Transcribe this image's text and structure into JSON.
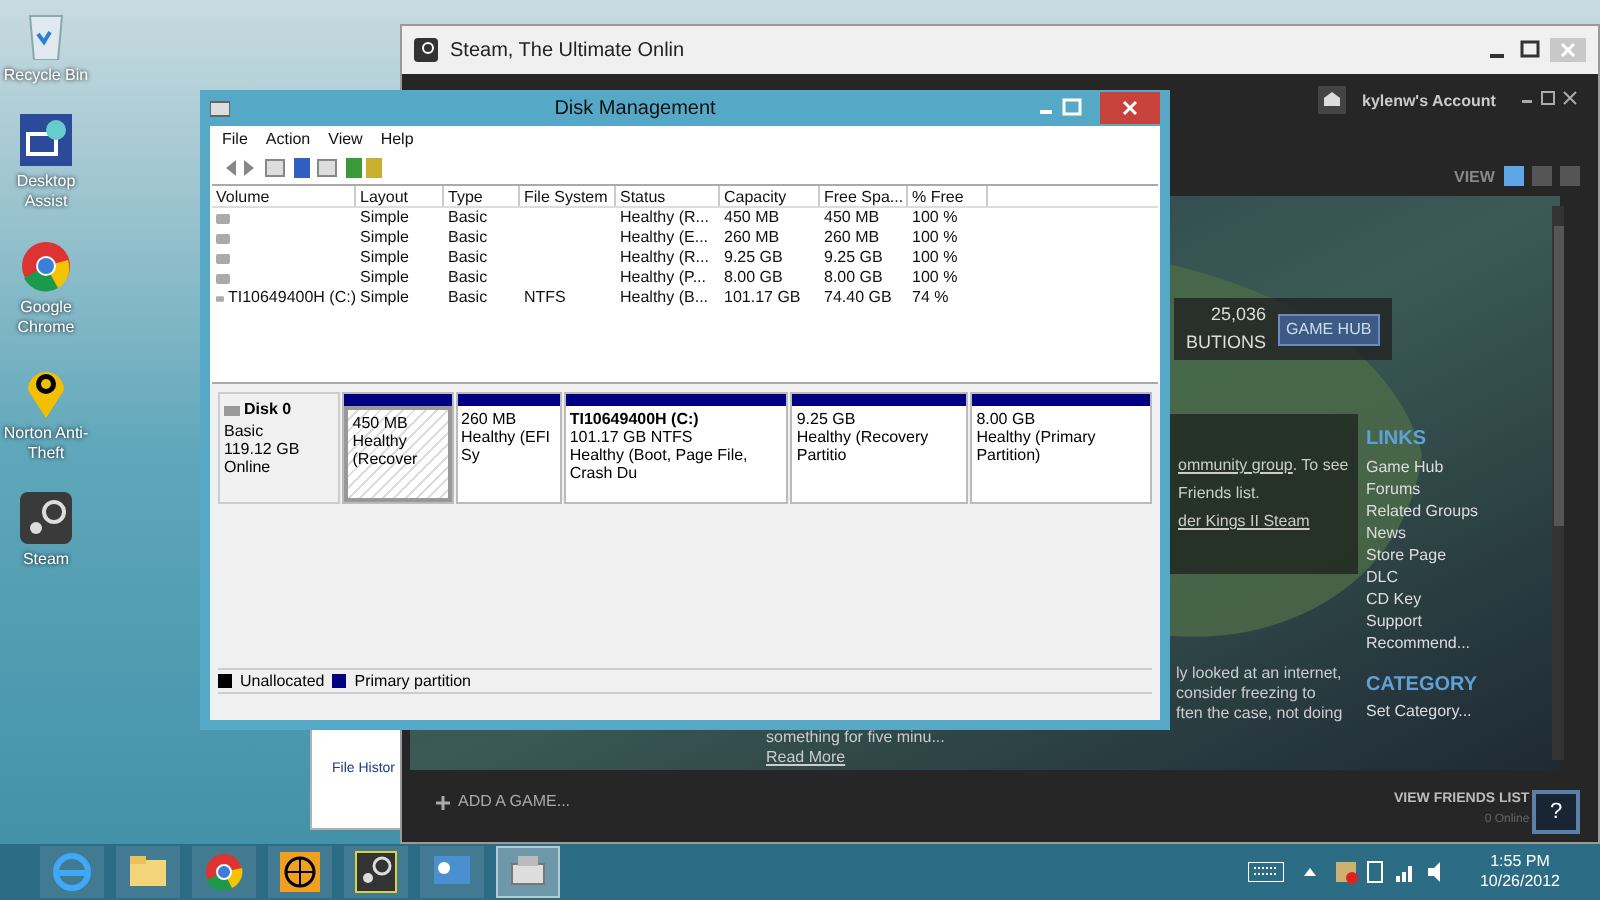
{
  "desktop_icons": [
    {
      "label": "Recycle Bin"
    },
    {
      "label": "Desktop Assist"
    },
    {
      "label": "Google Chrome"
    },
    {
      "label": "Norton Anti-Theft"
    },
    {
      "label": "Steam"
    }
  ],
  "file_history_window": {
    "label": "File Histor"
  },
  "steam": {
    "title": "Steam, The Ultimate Onlin",
    "account": "kylenw's Account",
    "view_label": "VIEW",
    "view_modes": [
      {
        "selected": true
      },
      {
        "selected": false
      },
      {
        "selected": false
      }
    ],
    "contributions": {
      "count": "25,036",
      "label": "BUTIONS"
    },
    "game_hub_button": "GAME HUB",
    "news_lines": [
      {
        "text": "ommunity group",
        "link": true
      },
      {
        "text": ". To see",
        "link": false
      },
      {
        "text": "Friends list.",
        "link": false
      },
      {
        "text": "der Kings II Steam",
        "link": true
      }
    ],
    "links_heading": "LINKS",
    "links": [
      "Game Hub",
      "Forums",
      "Related Groups",
      "News",
      "Store Page",
      "DLC",
      "CD Key",
      "Support",
      "Recommend..."
    ],
    "category_heading": "CATEGORY",
    "category_link": "Set Category...",
    "description_lines": [
      "ly looked at an internet,",
      "consider freezing to",
      "ften the case, not doing"
    ],
    "description_tail": "something for five minu...",
    "read_more": "Read More",
    "add_game": "ADD A GAME...",
    "friends": {
      "label": "VIEW FRIENDS LIST",
      "status": "0 Online"
    },
    "help_button": "?"
  },
  "disk_management": {
    "title": "Disk Management",
    "menu": [
      "File",
      "Action",
      "View",
      "Help"
    ],
    "volume_table": {
      "columns": [
        "Volume",
        "Layout",
        "Type",
        "File System",
        "Status",
        "Capacity",
        "Free Spa...",
        "% Free"
      ],
      "rows": [
        {
          "layout": "Simple",
          "type": "Basic",
          "status": "Healthy (R...",
          "capacity": "450 MB",
          "free": "450 MB",
          "percent_free": "100 %"
        },
        {
          "layout": "Simple",
          "type": "Basic",
          "status": "Healthy (E...",
          "capacity": "260 MB",
          "free": "260 MB",
          "percent_free": "100 %"
        },
        {
          "layout": "Simple",
          "type": "Basic",
          "status": "Healthy (R...",
          "capacity": "9.25 GB",
          "free": "9.25 GB",
          "percent_free": "100 %"
        },
        {
          "layout": "Simple",
          "type": "Basic",
          "status": "Healthy (P...",
          "capacity": "8.00 GB",
          "free": "8.00 GB",
          "percent_free": "100 %"
        },
        {
          "volume": "TI10649400H (C:)",
          "layout": "Simple",
          "type": "Basic",
          "file_system": "NTFS",
          "status": "Healthy (B...",
          "capacity": "101.17 GB",
          "free": "74.40 GB",
          "percent_free": "74 %"
        }
      ]
    },
    "disk": {
      "name": "Disk 0",
      "type": "Basic",
      "size": "119.12 GB",
      "status": "Online"
    },
    "partitions": [
      {
        "size": "450 MB",
        "status": "Healthy (Recover",
        "selected": true
      },
      {
        "size": "260 MB",
        "status": "Healthy (EFI Sy",
        "selected": false
      },
      {
        "label": "TI10649400H  (C:)",
        "size": "101.17 GB NTFS",
        "status": "Healthy (Boot, Page File, Crash Du",
        "selected": false
      },
      {
        "size": "9.25 GB",
        "status": "Healthy (Recovery Partitio",
        "selected": false
      },
      {
        "size": "8.00 GB",
        "status": "Healthy (Primary Partition)",
        "selected": false
      }
    ],
    "legend": [
      {
        "label": "Unallocated",
        "color": "#000000"
      },
      {
        "label": "Primary partition",
        "color": "#000080"
      }
    ]
  },
  "taskbar": {
    "apps": [
      {
        "kind": "ie",
        "selected": false
      },
      {
        "kind": "explorer",
        "selected": false
      },
      {
        "kind": "chrome",
        "selected": false
      },
      {
        "kind": "globe",
        "selected": false
      },
      {
        "kind": "steam",
        "selected": false
      },
      {
        "kind": "panel",
        "selected": false
      },
      {
        "kind": "disk",
        "selected": true
      }
    ],
    "time": "1:55 PM",
    "date": "10/26/2012"
  }
}
